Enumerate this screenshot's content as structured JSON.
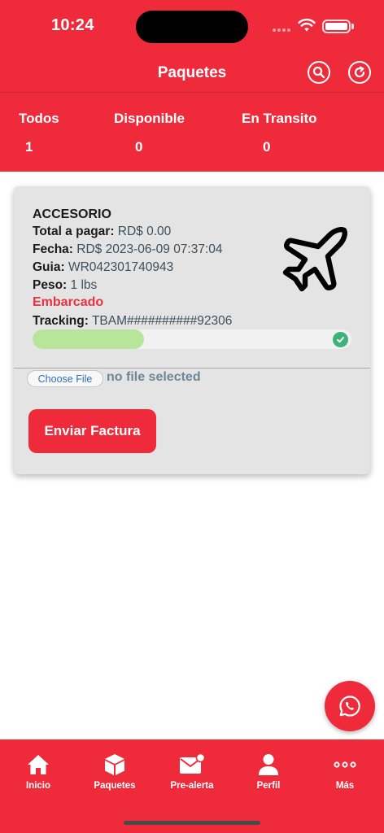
{
  "status_bar": {
    "time": "10:24"
  },
  "header": {
    "title": "Paquetes",
    "stats": [
      {
        "label": "Todos",
        "value": "1"
      },
      {
        "label": "Disponible",
        "value": "0"
      },
      {
        "label": "En Transito",
        "value": "0"
      }
    ]
  },
  "package": {
    "product": "ACCESORIO",
    "total_label": "Total a pagar:",
    "total_value": "RD$ 0.00",
    "fecha_label": "Fecha:",
    "fecha_value": "RD$ 2023-06-09 07:37:04",
    "guia_label": "Guia:",
    "guia_value": "WR042301740943",
    "peso_label": "Peso:",
    "peso_value": "1  lbs",
    "status": "Embarcado",
    "tracking_label": "Tracking:",
    "tracking_value": "TBAM##########92306",
    "progress_percent": 35,
    "file_button": "Choose File",
    "file_status": "no file selected",
    "send_button": "Enviar Factura"
  },
  "colors": {
    "accent": "#ef2b3b",
    "status_red": "#e8323f",
    "progress_fill": "#b7e59a",
    "check": "#3bb37a"
  },
  "tabs": [
    {
      "label": "Inicio",
      "icon": "home-icon"
    },
    {
      "label": "Paquetes",
      "icon": "package-icon"
    },
    {
      "label": "Pre-alerta",
      "icon": "mail-alert-icon"
    },
    {
      "label": "Perfil",
      "icon": "user-icon"
    },
    {
      "label": "Más",
      "icon": "more-dots-icon"
    }
  ]
}
